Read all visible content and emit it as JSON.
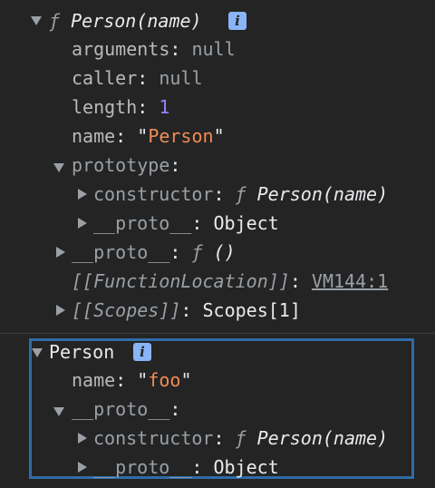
{
  "tree1": {
    "root": {
      "f": "ƒ",
      "label": "Person(name)",
      "badge": "i"
    },
    "arguments": {
      "key": "arguments",
      "colon": ":",
      "value": "null"
    },
    "caller": {
      "key": "caller",
      "colon": ":",
      "value": "null"
    },
    "length": {
      "key": "length",
      "colon": ":",
      "value": "1"
    },
    "name": {
      "key": "name",
      "colon": ":",
      "q1": "\"",
      "value": "Person",
      "q2": "\""
    },
    "prototype": {
      "key": "prototype",
      "colon": ":"
    },
    "constructor": {
      "key": "constructor",
      "colon": ":",
      "f": "ƒ",
      "value": "Person(name)"
    },
    "proto_inner": {
      "key": "__proto__",
      "colon": ":",
      "value": "Object"
    },
    "proto": {
      "key": "__proto__",
      "colon": ":",
      "f": "ƒ",
      "value": "()"
    },
    "function_location": {
      "key": "[[FunctionLocation]]",
      "colon": ":",
      "value": "VM144:1"
    },
    "scopes": {
      "key": "[[Scopes]]",
      "colon": ":",
      "value": "Scopes[1]"
    }
  },
  "tree2": {
    "root": {
      "label": "Person",
      "badge": "i"
    },
    "name": {
      "key": "name",
      "colon": ":",
      "q1": "\"",
      "value": "foo",
      "q2": "\""
    },
    "proto": {
      "key": "__proto__",
      "colon": ":"
    },
    "constructor": {
      "key": "constructor",
      "colon": ":",
      "f": "ƒ",
      "value": "Person(name)"
    },
    "proto_inner": {
      "key": "__proto__",
      "colon": ":",
      "value": "Object"
    }
  },
  "colors": {
    "background": "#242424",
    "key": "#9aa0a6",
    "number": "#9980ff",
    "string": "#f28b54",
    "badge": "#8ab4f8",
    "highlight_border": "#2f6ca8"
  }
}
